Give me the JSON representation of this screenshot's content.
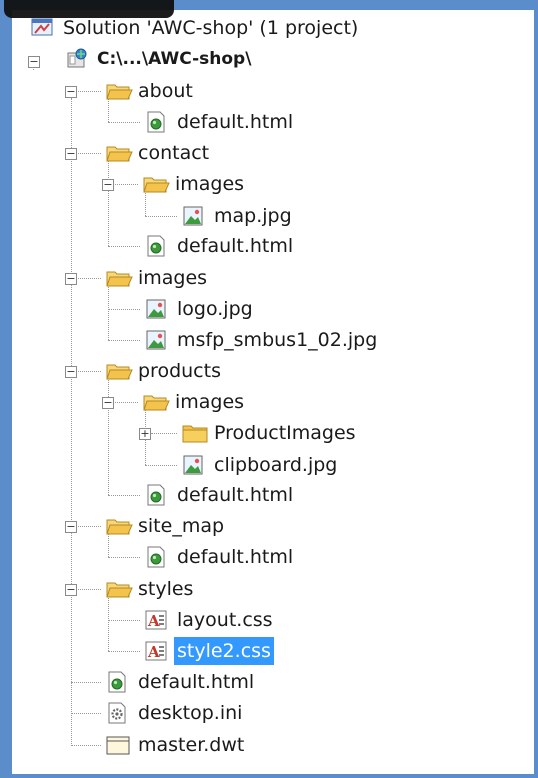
{
  "tree": {
    "solution_label": "Solution 'AWC-shop' (1 project)",
    "project_label": "C:\\...\\AWC-shop\\",
    "about": {
      "label": "about",
      "default": "default.html"
    },
    "contact": {
      "label": "contact",
      "images": {
        "label": "images",
        "map": "map.jpg"
      },
      "default": "default.html"
    },
    "images": {
      "label": "images",
      "logo": "logo.jpg",
      "msfp": "msfp_smbus1_02.jpg"
    },
    "products": {
      "label": "products",
      "images": {
        "label": "images",
        "product_images": "ProductImages",
        "clipboard": "clipboard.jpg"
      },
      "default": "default.html"
    },
    "site_map": {
      "label": "site_map",
      "default": "default.html"
    },
    "styles": {
      "label": "styles",
      "layout": "layout.css",
      "style2": "style2.css"
    },
    "root_default": "default.html",
    "desktop_ini": "desktop.ini",
    "master_dwt": "master.dwt"
  },
  "colors": {
    "selection": "#3399ff",
    "frame": "#5a8dc9",
    "folder": "#f4c34c"
  }
}
